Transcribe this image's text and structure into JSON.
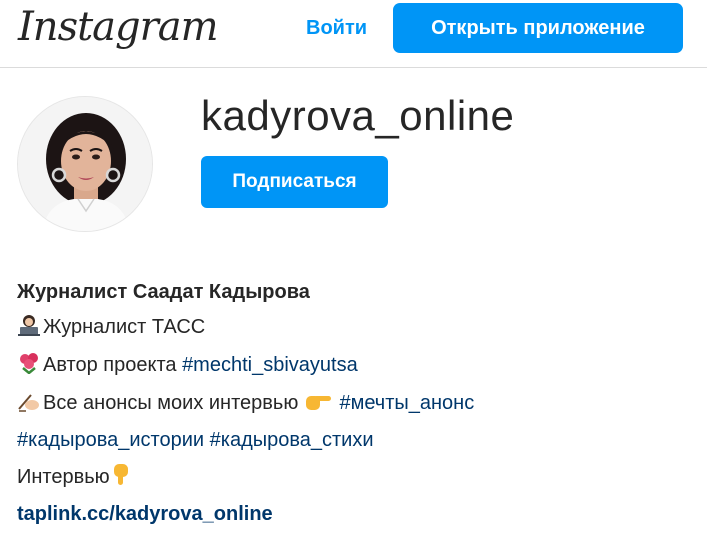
{
  "header": {
    "logo_text": "Instagram",
    "login_label": "Войти",
    "open_app_label": "Открыть приложение"
  },
  "profile": {
    "username": "kadyrova_online",
    "follow_label": "Подписаться",
    "avatar_icon": "profile-photo"
  },
  "bio": {
    "name": "Журналист Саадат Кадырова",
    "line1_text": "Журналист ТАСС",
    "line2_text": "Автор проекта ",
    "line2_tag": "#mechti_sbivayutsa",
    "line3_text": "Все анонсы моих интервью ",
    "line3_tag": "#мечты_анонс",
    "line4_tag1": "#кадырова_истории",
    "line4_tag2": "#кадырова_стихи",
    "line5_text": "Интервью",
    "link": "taplink.cc/kadyrova_online"
  },
  "colors": {
    "accent": "#0095f6",
    "link": "#00376b",
    "text": "#262626"
  }
}
